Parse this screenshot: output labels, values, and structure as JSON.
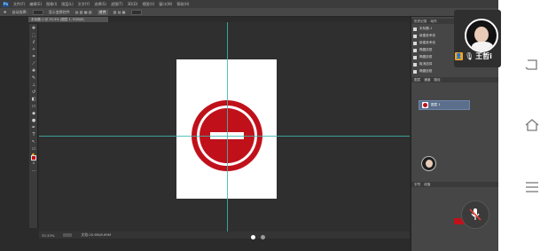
{
  "app": {
    "logo": "Ps"
  },
  "menubar": {
    "items": [
      "文件(F)",
      "编辑(E)",
      "图像(I)",
      "图层(L)",
      "文字(Y)",
      "选择(S)",
      "滤镜(T)",
      "3D(D)",
      "视图(V)",
      "窗口(W)",
      "帮助(H)"
    ]
  },
  "optionsbar": {
    "items": [
      "自动选择:",
      "组",
      "显示变换控件"
    ],
    "selected": "对齐"
  },
  "document": {
    "tab_title": "未标题-1 @ 33.3% (图层 1, RGB/8)"
  },
  "status": {
    "zoom": "33.33%",
    "doc_info": "文档:20.6M/8.69M"
  },
  "history_panel": {
    "tabs": [
      "历史记录",
      "动作"
    ],
    "items": [
      "未标题-1",
      "新建参考线",
      "新建参考线",
      "椭圆选框",
      "椭圆选框",
      "取消选择",
      "椭圆选框"
    ]
  },
  "layers_panel": {
    "tabs": [
      "图层",
      "通道",
      "路径"
    ],
    "layer_name": "图层 1"
  },
  "properties_panel": {
    "tabs": [
      "字符",
      "段落"
    ]
  },
  "colors": {
    "sign_red": "#c0111b",
    "guide": "#3fb6ad"
  },
  "live": {
    "host_name": "王哲i"
  },
  "pager": {
    "pages": 2,
    "active": 1
  },
  "android_nav": [
    "back-icon",
    "home-icon",
    "menu-icon"
  ]
}
